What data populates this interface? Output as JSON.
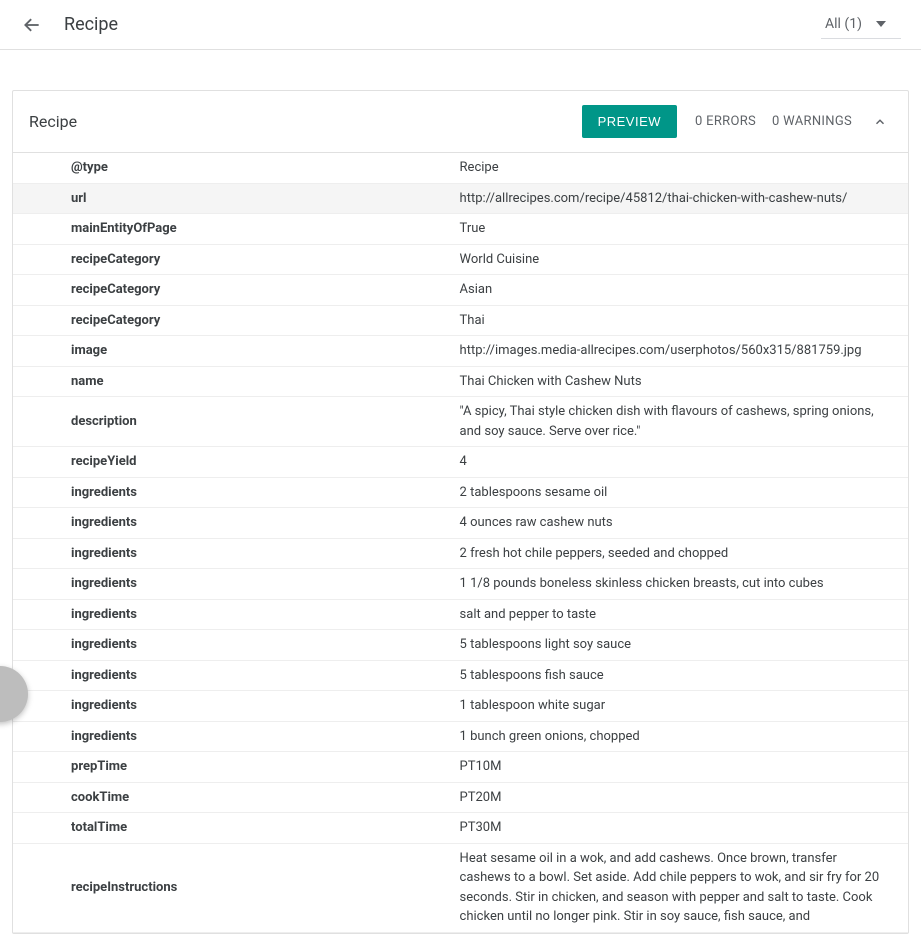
{
  "header": {
    "title": "Recipe",
    "filter_label": "All (1)"
  },
  "card": {
    "title": "Recipe",
    "preview_label": "PREVIEW",
    "errors_label": "0 ERRORS",
    "warnings_label": "0 WARNINGS"
  },
  "rows": [
    {
      "key": "@type",
      "value": "Recipe",
      "highlight": false
    },
    {
      "key": "url",
      "value": "http://allrecipes.com/recipe/45812/thai-chicken-with-cashew-nuts/",
      "highlight": true
    },
    {
      "key": "mainEntityOfPage",
      "value": "True",
      "highlight": false
    },
    {
      "key": "recipeCategory",
      "value": "World Cuisine",
      "highlight": false
    },
    {
      "key": "recipeCategory",
      "value": "Asian",
      "highlight": false
    },
    {
      "key": "recipeCategory",
      "value": "Thai",
      "highlight": false
    },
    {
      "key": "image",
      "value": "http://images.media-allrecipes.com/userphotos/560x315/881759.jpg",
      "highlight": false
    },
    {
      "key": "name",
      "value": "Thai Chicken with Cashew Nuts",
      "highlight": false
    },
    {
      "key": "description",
      "value": "\"A spicy, Thai style chicken dish with flavours of cashews, spring onions, and soy sauce. Serve over rice.\"",
      "highlight": false
    },
    {
      "key": "recipeYield",
      "value": "4",
      "highlight": false
    },
    {
      "key": "ingredients",
      "value": "2 tablespoons sesame oil",
      "highlight": false
    },
    {
      "key": "ingredients",
      "value": "4 ounces raw cashew nuts",
      "highlight": false
    },
    {
      "key": "ingredients",
      "value": "2 fresh hot chile peppers, seeded and chopped",
      "highlight": false
    },
    {
      "key": "ingredients",
      "value": "1 1/8 pounds boneless skinless chicken breasts, cut into cubes",
      "highlight": false
    },
    {
      "key": "ingredients",
      "value": "salt and pepper to taste",
      "highlight": false
    },
    {
      "key": "ingredients",
      "value": "5 tablespoons light soy sauce",
      "highlight": false
    },
    {
      "key": "ingredients",
      "value": "5 tablespoons fish sauce",
      "highlight": false
    },
    {
      "key": "ingredients",
      "value": "1 tablespoon white sugar",
      "highlight": false
    },
    {
      "key": "ingredients",
      "value": "1 bunch green onions, chopped",
      "highlight": false
    },
    {
      "key": "prepTime",
      "value": "PT10M",
      "highlight": false
    },
    {
      "key": "cookTime",
      "value": "PT20M",
      "highlight": false
    },
    {
      "key": "totalTime",
      "value": "PT30M",
      "highlight": false
    },
    {
      "key": "recipeInstructions",
      "value": "Heat sesame oil in a wok, and add cashews. Once brown, transfer cashews to a bowl. Set aside. Add chile peppers to wok, and sir fry for 20 seconds. Stir in chicken, and season with pepper and salt to taste. Cook chicken until no longer pink. Stir in soy sauce, fish sauce, and",
      "highlight": false
    }
  ]
}
